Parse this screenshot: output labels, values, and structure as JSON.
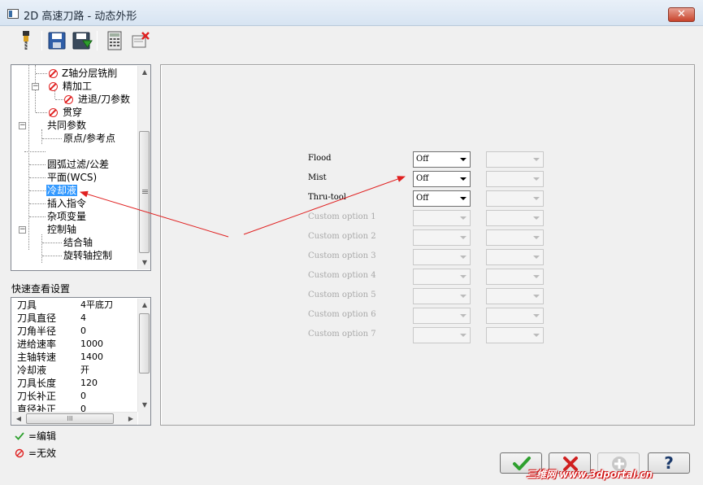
{
  "window": {
    "title": "2D 高速刀路 - 动态外形",
    "close_label": "✕"
  },
  "toolbar": {
    "icons": [
      "tool-icon",
      "save-icon",
      "save-as-icon",
      "calculator-icon",
      "clear-icon"
    ]
  },
  "tree": {
    "items": [
      {
        "label": "Z轴分层铣削",
        "state": "disabled"
      },
      {
        "label": "精加工",
        "state": "disabled"
      },
      {
        "label": "进退/刀参数",
        "state": "disabled"
      },
      {
        "label": "贯穿",
        "state": "disabled"
      },
      {
        "label": "共同参数",
        "state": ""
      },
      {
        "label": "原点/参考点",
        "state": ""
      },
      {
        "label": "",
        "state": ""
      },
      {
        "label": "圆弧过滤/公差",
        "state": ""
      },
      {
        "label": "平面(WCS)",
        "state": ""
      },
      {
        "label": "冷却液",
        "state": "selected"
      },
      {
        "label": "插入指令",
        "state": ""
      },
      {
        "label": "杂项变量",
        "state": ""
      },
      {
        "label": "控制轴",
        "state": ""
      },
      {
        "label": "结合轴",
        "state": ""
      },
      {
        "label": "旋转轴控制",
        "state": ""
      }
    ]
  },
  "quick_view": {
    "title": "快速查看设置",
    "rows": [
      {
        "key": "刀具",
        "value": "4平底刀"
      },
      {
        "key": "刀具直径",
        "value": "4"
      },
      {
        "key": "刀角半径",
        "value": "0"
      },
      {
        "key": "进给速率",
        "value": "1000"
      },
      {
        "key": "主轴转速",
        "value": "1400"
      },
      {
        "key": "冷却液",
        "value": "开"
      },
      {
        "key": "刀具长度",
        "value": "120"
      },
      {
        "key": "刀长补正",
        "value": "0"
      },
      {
        "key": "直径补正",
        "value": "0"
      }
    ],
    "hscroll_grip": "III"
  },
  "legend": {
    "edit": "=编辑",
    "disabled": "=无效"
  },
  "coolant": {
    "options": [
      {
        "label": "Flood",
        "value": "Off",
        "enabled": true
      },
      {
        "label": "Mist",
        "value": "Off",
        "enabled": true
      },
      {
        "label": "Thru-tool",
        "value": "Off",
        "enabled": true
      },
      {
        "label": "Custom option 1",
        "value": "",
        "enabled": false
      },
      {
        "label": "Custom option 2",
        "value": "",
        "enabled": false
      },
      {
        "label": "Custom option 3",
        "value": "",
        "enabled": false
      },
      {
        "label": "Custom option 4",
        "value": "",
        "enabled": false
      },
      {
        "label": "Custom option 5",
        "value": "",
        "enabled": false
      },
      {
        "label": "Custom option 6",
        "value": "",
        "enabled": false
      },
      {
        "label": "Custom option 7",
        "value": "",
        "enabled": false
      }
    ]
  },
  "buttons": {
    "ok_icon": "check-icon",
    "cancel_icon": "x-icon",
    "add_icon": "plus-icon",
    "help_label": "?"
  },
  "watermark": "三维网 www.3dportal.cn",
  "colors": {
    "selection": "#3399ff",
    "annotation_arrow": "#e02020",
    "ok_green": "#2ea02e",
    "cancel_red": "#d02020"
  }
}
